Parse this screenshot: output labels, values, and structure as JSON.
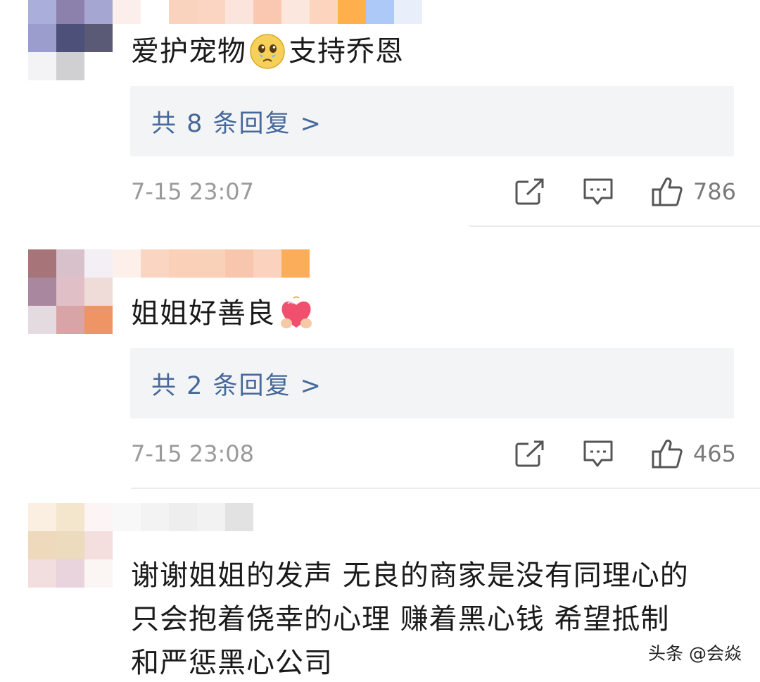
{
  "comments": [
    {
      "avatar_colors": [
        "#a9aedb",
        "#8c80ad",
        "#a6a6d3",
        "#9b9dcc",
        "#4d5179",
        "#5a5a76",
        "#f3f3f6",
        "#d0d0d3",
        "#ffffff"
      ],
      "name_colors": [
        "#fcefeb",
        "#ffffff",
        "#fad3bf",
        "#fbd4c2",
        "#fae4db",
        "#fac7b0",
        "#fbe7dd",
        "#fdd4be",
        "#ffb04d",
        "#acc9f7",
        "#e8effb"
      ],
      "text": "爱护宠物",
      "emoji": "teary-face-emoji",
      "text_after": "支持乔恩",
      "replies": "共 8 条回复 >",
      "time": "7-15 23:07",
      "likes": "786"
    },
    {
      "avatar_colors": [
        "#a7747a",
        "#d8c1cb",
        "#f3eff5",
        "#a8879f",
        "#e0c0c6",
        "#efdcd9",
        "#e4dbe0",
        "#d9a4a6",
        "#ef9565"
      ],
      "name_colors": [
        "#fdf0ea",
        "#fad6c2",
        "#fbd0b8",
        "#f9d0b8",
        "#f8c6ad",
        "#fad2bd",
        "#fbad5a"
      ],
      "text": "姐姐好善良",
      "emoji": "heart-hands-emoji",
      "replies": "共 2 条回复 >",
      "time": "7-15 23:08",
      "likes": "465"
    },
    {
      "avatar_colors": [
        "#fbefe2",
        "#f3e6cd",
        "#fdf5f5",
        "#eed9bd",
        "#ecdbbd",
        "#f4dede",
        "#f2dede",
        "#e9d3dc",
        "#fbf6f3"
      ],
      "name_colors": [
        "#f8f8f8",
        "#f3f3f3",
        "#eeeeee",
        "#f2f2f2",
        "#e2e2e2"
      ],
      "lines": [
        "谢谢姐姐的发声 无良的商家是没有同理心的",
        "只会抱着侥幸的心理 赚着黑心钱 希望抵制",
        "和严惩黑心公司"
      ]
    }
  ],
  "watermark": "头条 @会焱"
}
